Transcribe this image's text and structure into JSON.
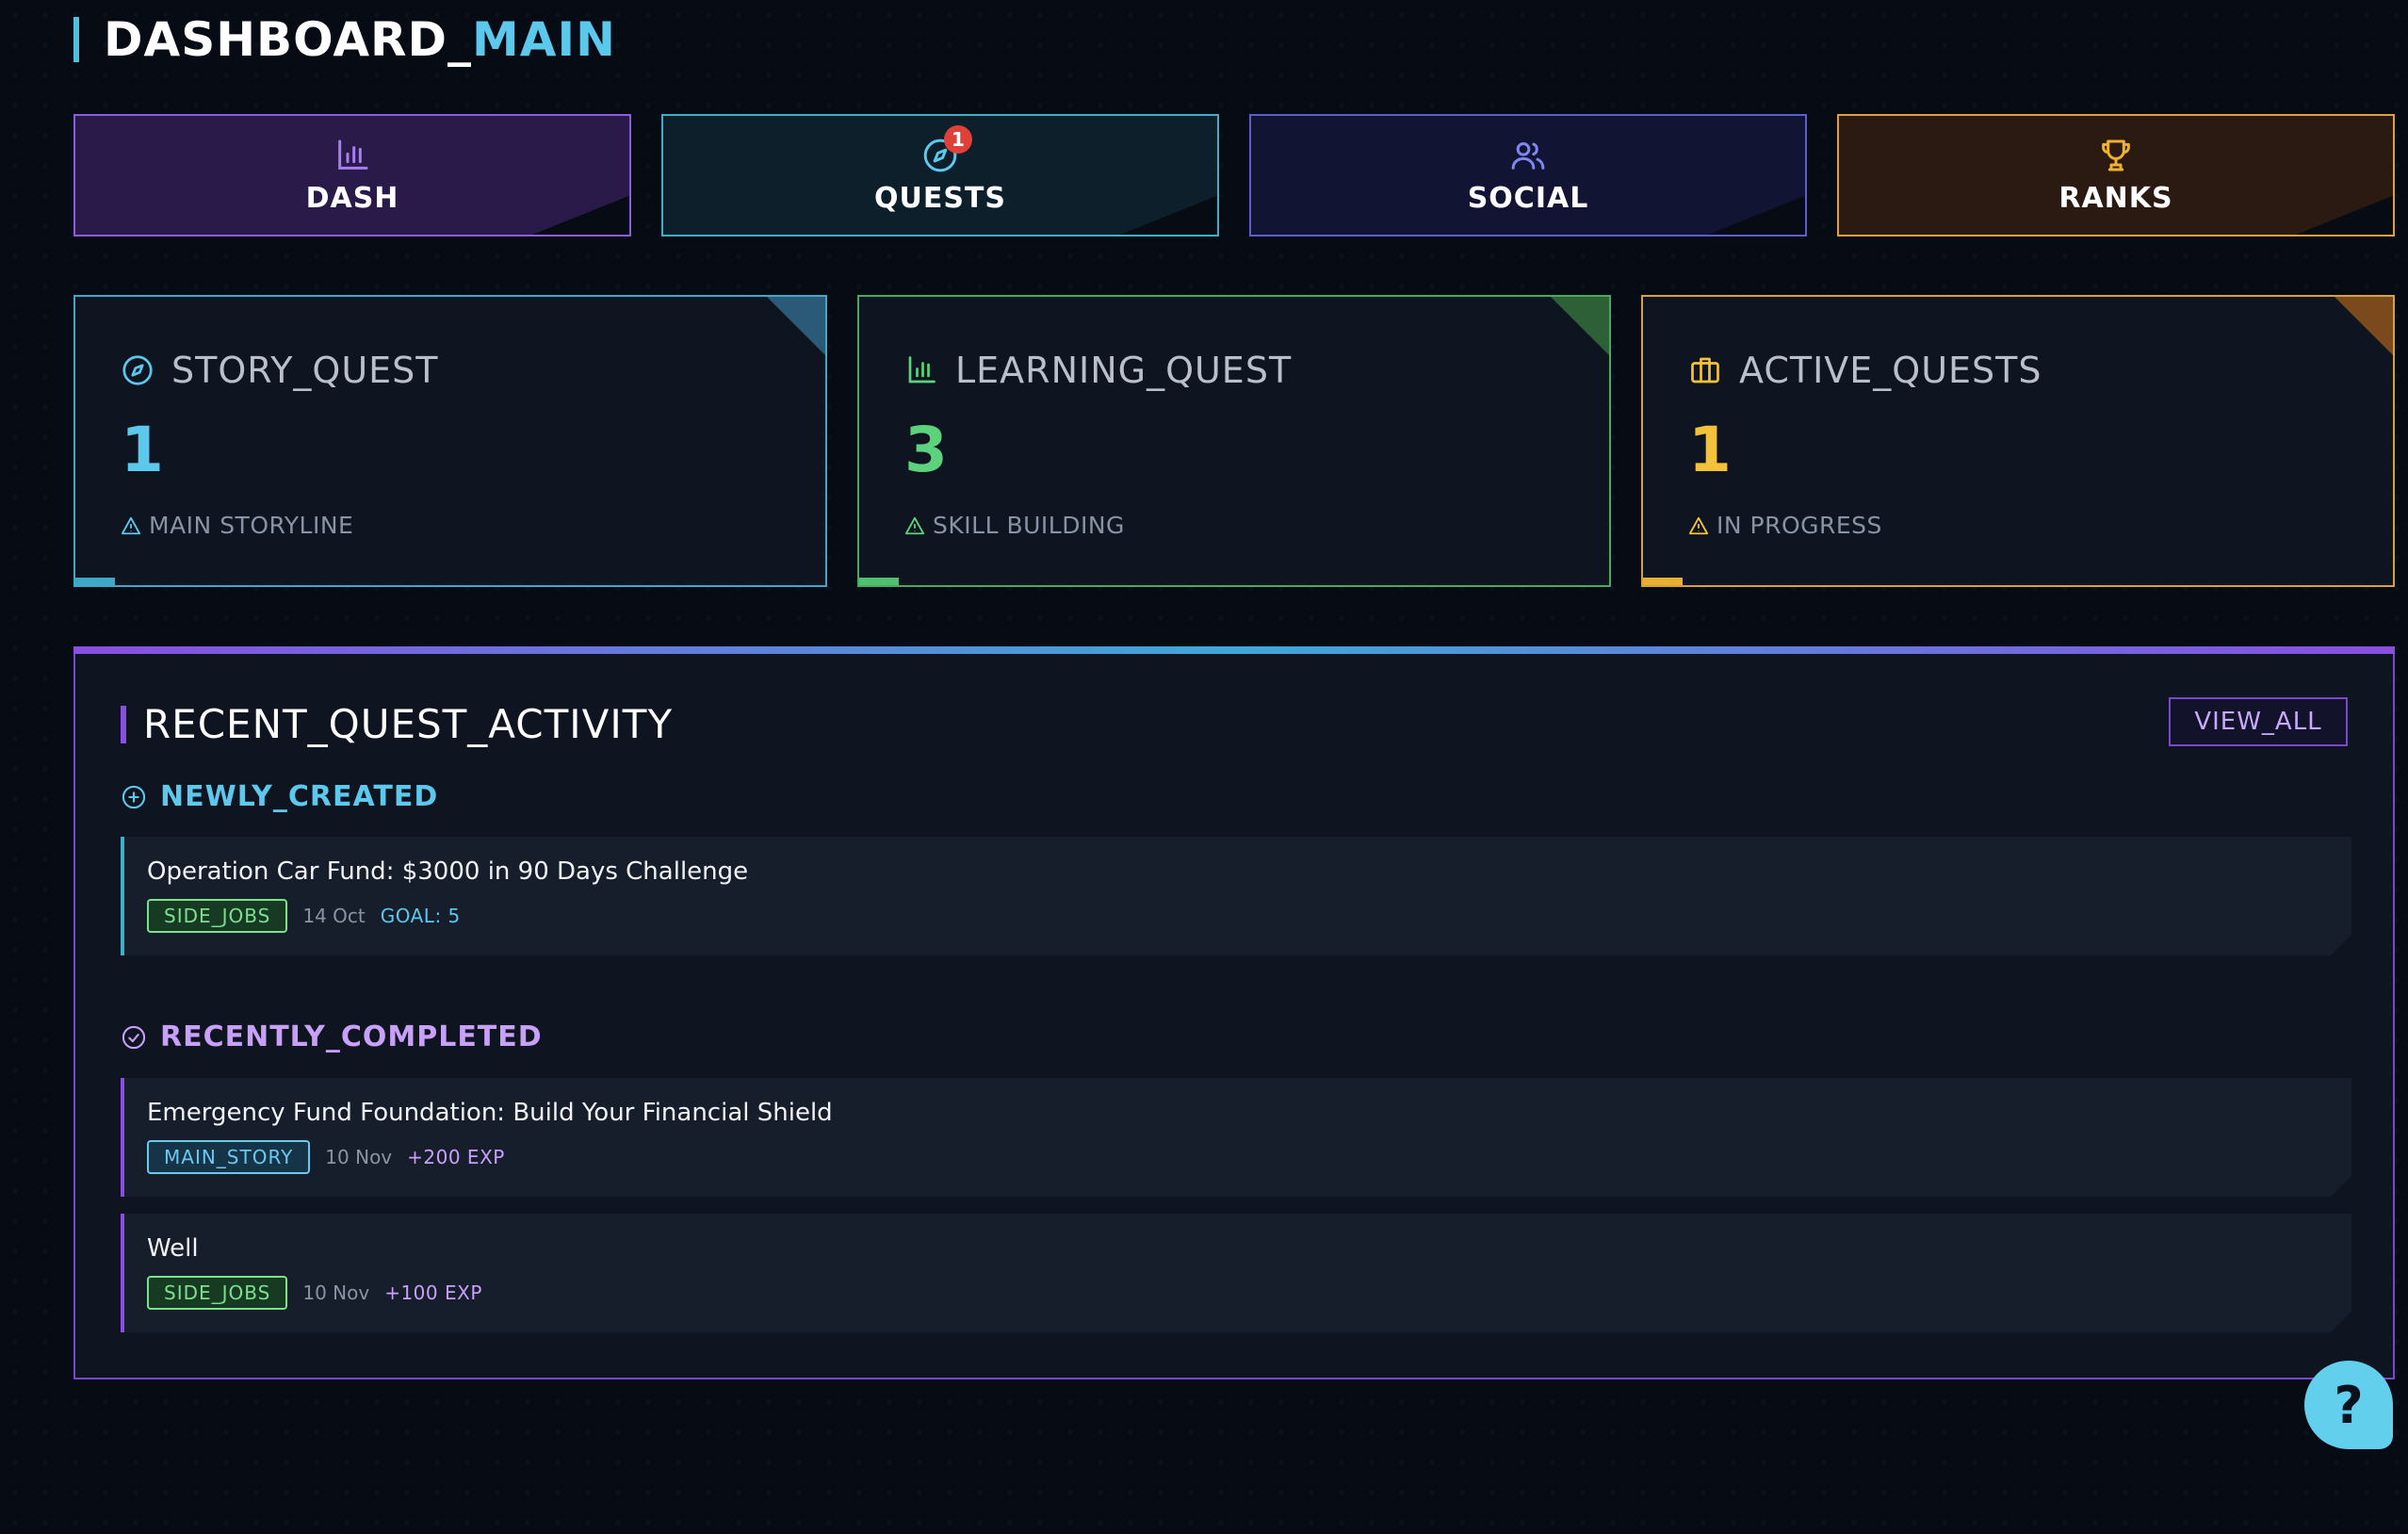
{
  "header": {
    "title_main": "DASHBOARD_",
    "title_accent": "MAIN"
  },
  "nav": {
    "tabs": [
      {
        "label": "DASH",
        "icon": "bar-chart-icon"
      },
      {
        "label": "QUESTS",
        "icon": "compass-icon",
        "badge": "1"
      },
      {
        "label": "SOCIAL",
        "icon": "users-icon"
      },
      {
        "label": "RANKS",
        "icon": "trophy-icon"
      }
    ]
  },
  "stats": [
    {
      "title": "STORY_QUEST",
      "value": "1",
      "subtitle": "MAIN STORYLINE",
      "icon": "compass-icon",
      "color": "#5cc8ec"
    },
    {
      "title": "LEARNING_QUEST",
      "value": "3",
      "subtitle": "SKILL BUILDING",
      "icon": "bar-chart-icon",
      "color": "#5cd27c"
    },
    {
      "title": "ACTIVE_QUESTS",
      "value": "1",
      "subtitle": "IN PROGRESS",
      "icon": "briefcase-icon",
      "color": "#f4c238"
    }
  ],
  "activity": {
    "title": "RECENT_QUEST_ACTIVITY",
    "view_all": "VIEW_ALL",
    "newly_created": {
      "title": "NEWLY_CREATED",
      "items": [
        {
          "title": "Operation Car Fund: $3000 in 90 Days Challenge",
          "tag": "SIDE_JOBS",
          "date": "14 Oct",
          "extra": "GOAL: 5"
        }
      ]
    },
    "recently_completed": {
      "title": "RECENTLY_COMPLETED",
      "items": [
        {
          "title": "Emergency Fund Foundation: Build Your Financial Shield",
          "tag": "MAIN_STORY",
          "date": "10 Nov",
          "extra": "+200 EXP"
        },
        {
          "title": "Well",
          "tag": "SIDE_JOBS",
          "date": "10 Nov",
          "extra": "+100 EXP"
        }
      ]
    }
  },
  "help": {
    "label": "?"
  }
}
